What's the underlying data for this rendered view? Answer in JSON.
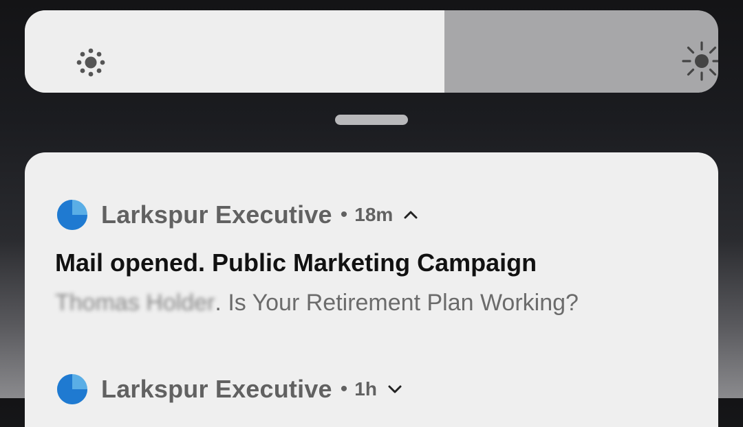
{
  "brightness": {
    "level": 0.605,
    "low_icon": "brightness-low-icon",
    "high_icon": "brightness-high-icon",
    "track_color": "#a7a7a9",
    "fill_color": "#eeeeee"
  },
  "notifications": [
    {
      "app_name": "Larkspur Executive",
      "separator": "•",
      "time": "18m",
      "expanded": true,
      "chevron_icon": "chevron-up-icon",
      "title": "Mail opened. Public Marketing Campaign",
      "sender_redacted": "Thomas Holder",
      "body": ". Is Your Retirement Plan Working?"
    },
    {
      "app_name": "Larkspur Executive",
      "separator": "•",
      "time": "1h",
      "expanded": false,
      "chevron_icon": "chevron-down-icon"
    }
  ],
  "colors": {
    "app_icon_primary": "#1f7ad1",
    "app_icon_secondary": "#5aaee6",
    "card_background": "#efefef"
  }
}
